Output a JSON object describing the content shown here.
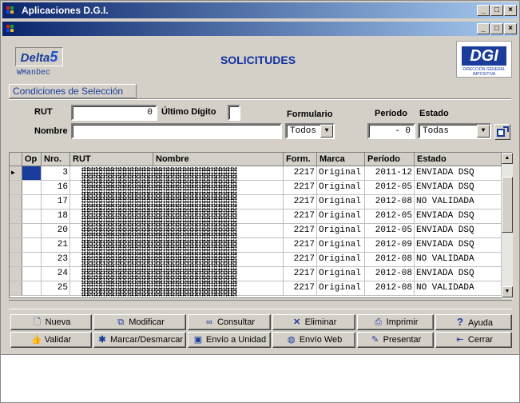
{
  "window": {
    "title": "Aplicaciones  D.G.I."
  },
  "header": {
    "logo_text": "Delta",
    "logo_number": "5",
    "program_name": "WManDec",
    "page_title": "SOLICITUDES",
    "org_logo": {
      "mark": "DGI",
      "subtitle": "DIRECCIÓN GENERAL IMPOSITIVA"
    }
  },
  "conditions": {
    "tab_label": "Condiciones de Selección",
    "rut_label": "RUT",
    "rut_value": "0",
    "ultimo_digito_label": "Último Dígito",
    "ultimo_digito_value": "",
    "nombre_label": "Nombre",
    "nombre_value": "",
    "formulario_label": "Formulario",
    "formulario_value": "Todos",
    "periodo_label": "Período",
    "periodo_value": "- 0",
    "estado_label": "Estado",
    "estado_value": "Todas"
  },
  "grid": {
    "columns": [
      "Op",
      "Nro.",
      "RUT",
      "Nombre",
      "Form.",
      "Marca",
      "Período",
      "Estado"
    ],
    "rows": [
      {
        "nro": "3",
        "form": "2217",
        "marca": "Original",
        "periodo": "2011-12",
        "estado": "ENVIADA DSQ"
      },
      {
        "nro": "16",
        "form": "2217",
        "marca": "Original",
        "periodo": "2012-05",
        "estado": "ENVIADA DSQ"
      },
      {
        "nro": "17",
        "form": "2217",
        "marca": "Original",
        "periodo": "2012-08",
        "estado": "NO VALIDADA"
      },
      {
        "nro": "18",
        "form": "2217",
        "marca": "Original",
        "periodo": "2012-05",
        "estado": "ENVIADA DSQ"
      },
      {
        "nro": "20",
        "form": "2217",
        "marca": "Original",
        "periodo": "2012-05",
        "estado": "ENVIADA DSQ"
      },
      {
        "nro": "21",
        "form": "2217",
        "marca": "Original",
        "periodo": "2012-09",
        "estado": "ENVIADA DSQ"
      },
      {
        "nro": "23",
        "form": "2217",
        "marca": "Original",
        "periodo": "2012-08",
        "estado": "NO VALIDADA"
      },
      {
        "nro": "24",
        "form": "2217",
        "marca": "Original",
        "periodo": "2012-08",
        "estado": "ENVIADA DSQ"
      },
      {
        "nro": "25",
        "form": "2217",
        "marca": "Original",
        "periodo": "2012-08",
        "estado": "NO VALIDADA"
      }
    ]
  },
  "buttons": {
    "nueva": "Nueva",
    "modificar": "Modificar",
    "consultar": "Consultar",
    "eliminar": "Eliminar",
    "imprimir": "Imprimir",
    "ayuda": "Ayuda",
    "validar": "Validar",
    "marcar": "Marcar/Desmarcar",
    "envio_unidad": "Envío a Unidad",
    "envio_web": "Envío  Web",
    "presentar": "Presentar",
    "cerrar": "Cerrar"
  },
  "colors": {
    "titlebar": "#0a246a",
    "accent": "#1a3c9a",
    "face": "#d4d0c8"
  }
}
